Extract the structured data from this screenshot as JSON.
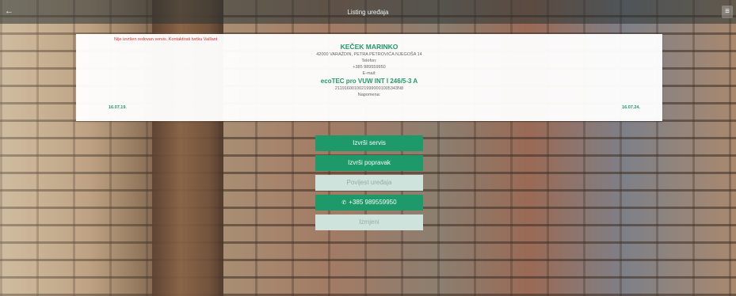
{
  "header": {
    "title": "Listing uređaja",
    "back_icon": "arrow-left-icon",
    "menu_icon": "hamburger-menu-icon"
  },
  "card": {
    "warning": "Nije izvršen redovan servis. Kontaktirati tvrtku Vaillant",
    "customer_name": "KEČEK MARINKO",
    "address": "42000 VARAŽDIN, PETRA PETROVIĆA NJEGOŠA 14",
    "phone_label": "Telefon:",
    "phone_value": "+385 989559950",
    "email_label": "E-mail:",
    "device_model": "ecoTEC pro VUW INT I 246/5-3 A",
    "serial_number": "21191600100219990001005343N8",
    "note_label": "Napomena:",
    "date_left": "16.07.19.",
    "date_right": "16.07.24."
  },
  "actions": {
    "service": "Izvrši servis",
    "repair": "Izvrši popravak",
    "history": "Povijest uređaja",
    "call": "+385 989559950",
    "call_icon": "phone-icon",
    "edit": "Izmjeni"
  },
  "colors": {
    "accent": "#1e9a6a",
    "warning": "#dd3333",
    "disabled": "#cfe3dd"
  }
}
